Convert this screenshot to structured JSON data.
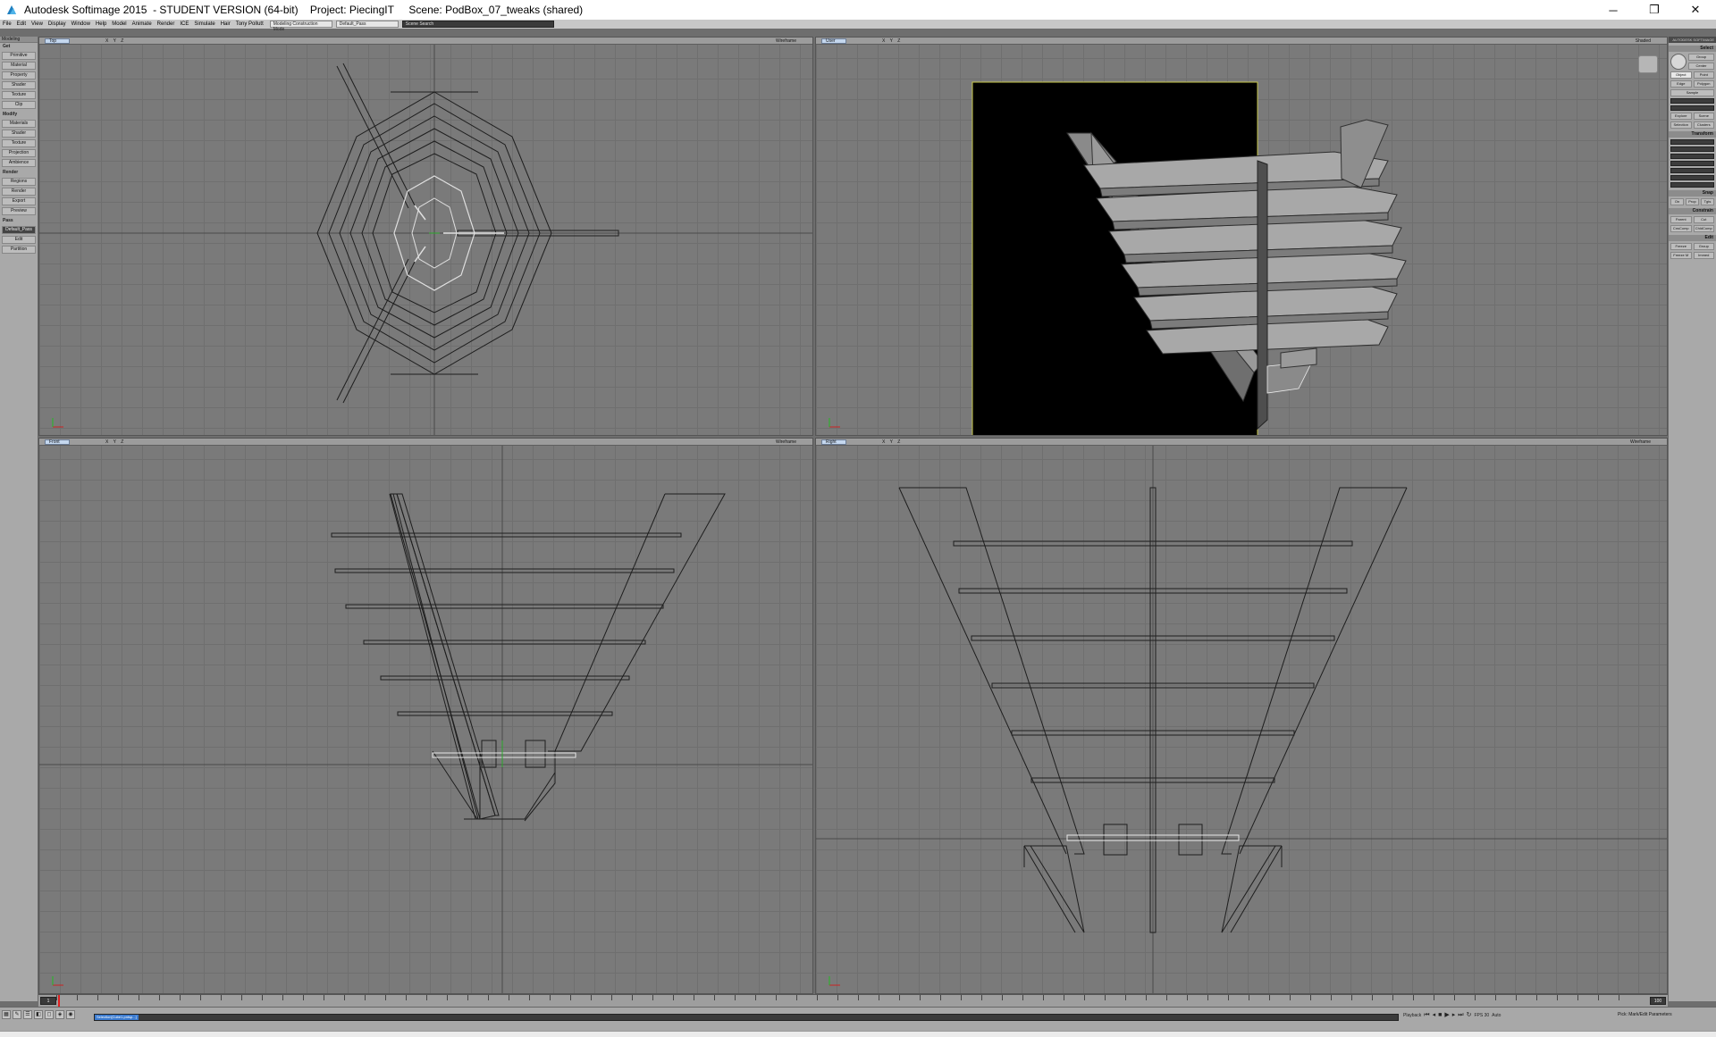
{
  "window": {
    "title": "Autodesk Softimage 2015  - STUDENT VERSION (64-bit)    Project: PiecingIT     Scene: PodBox_07_tweaks (shared)",
    "minimize_label": "─",
    "restore_label": "❐",
    "close_label": "✕"
  },
  "menubar": {
    "items": [
      "File",
      "Edit",
      "View",
      "Display",
      "Window",
      "Help",
      "Model",
      "Animate",
      "Render",
      "ICE",
      "Simulate",
      "Hair",
      "Tony Pollutt"
    ],
    "construction_mode": "Modeling Construction Mode",
    "pass": "Default_Pass",
    "search_placeholder": "Scene Search"
  },
  "left_panel": {
    "header": "Modeling",
    "sections": [
      {
        "title": "Get",
        "buttons": [
          "Primitive",
          "Material",
          "Property",
          "Shader",
          "Texture",
          "Clip"
        ]
      },
      {
        "title": "Modify",
        "buttons": [
          "Materials",
          "Shader",
          "Texture",
          "Projection",
          "Ambience"
        ]
      },
      {
        "title": "Render",
        "buttons": [
          "Regions",
          "Render",
          "Export",
          "Preview"
        ]
      },
      {
        "title": "Pass",
        "buttons": [
          "Edit",
          "Partition"
        ]
      }
    ],
    "selected_pass": "Default_Pass"
  },
  "viewports": {
    "top": {
      "name": "Top",
      "mode": "Wireframe",
      "tools": "X Y Z"
    },
    "user": {
      "name": "User",
      "mode": "Shaded",
      "tools": "X Y Z"
    },
    "front": {
      "name": "Front",
      "mode": "Wireframe",
      "tools": "X Y Z"
    },
    "right": {
      "name": "Right",
      "mode": "Wireframe",
      "tools": "X Y Z"
    }
  },
  "right_panel": {
    "brand": "AUTODESK SOFTIMAGE",
    "select_title": "Select",
    "select_buttons": [
      "Group",
      "Center",
      "Object",
      "Point",
      "Edge",
      "Polygon",
      "Sample"
    ],
    "explore": [
      "Explore",
      "Scene",
      "Selection",
      "Clusters"
    ],
    "transform_title": "Transform",
    "snap_title": "Snap",
    "snap_buttons": [
      "On",
      "Prop",
      "Tgts"
    ],
    "constrain_title": "Constrain",
    "constrain_buttons": [
      "Parent",
      "Cut",
      "CnsComp",
      "ChldComp"
    ],
    "edit_title": "Edit",
    "edit_buttons": [
      "Freeze",
      "Group",
      "Freeze M",
      "Immed"
    ]
  },
  "timeline": {
    "start_frame": "1",
    "end_frame": "100"
  },
  "bottombar": {
    "script_selection": "Selection[Cube1.pntsp...]",
    "playback_label": "Playback",
    "fps": "FPS 30",
    "auto_label": "Auto",
    "status_message": "Pick: Mark/Edit Parameters"
  }
}
